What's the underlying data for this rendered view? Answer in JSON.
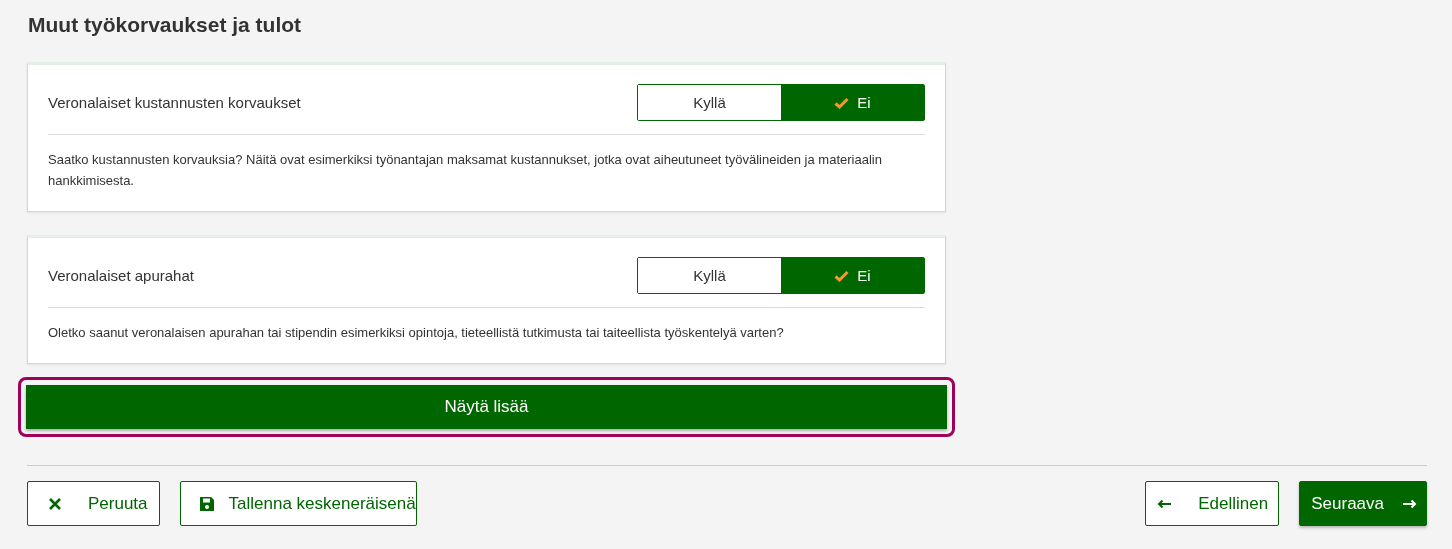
{
  "heading": "Muut työkorvaukset ja tulot",
  "questions": [
    {
      "label": "Veronalaiset kustannusten korvaukset",
      "options": [
        {
          "label": "Kyllä",
          "selected": false
        },
        {
          "label": "Ei",
          "selected": true
        }
      ],
      "description": "Saatko kustannusten korvauksia? Näitä ovat esimerkiksi työnantajan maksamat kustannukset, jotka ovat aiheutuneet työvälineiden ja materiaalin hankkimisesta."
    },
    {
      "label": "Veronalaiset apurahat",
      "options": [
        {
          "label": "Kyllä",
          "selected": false
        },
        {
          "label": "Ei",
          "selected": true
        }
      ],
      "description": "Oletko saanut veronalaisen apurahan tai stipendin esimerkiksi opintoja, tieteellistä tutkimusta tai taiteellista työskentelyä varten?"
    }
  ],
  "show_more": {
    "label": "Näytä lisää",
    "focused": true
  },
  "footer_buttons": [
    {
      "kind": "cancel",
      "label": "Peruuta"
    },
    {
      "kind": "save",
      "label": "Tallenna keskeneräisenä"
    },
    {
      "kind": "previous",
      "label": "Edellinen"
    },
    {
      "kind": "next",
      "label": "Seuraava"
    }
  ]
}
